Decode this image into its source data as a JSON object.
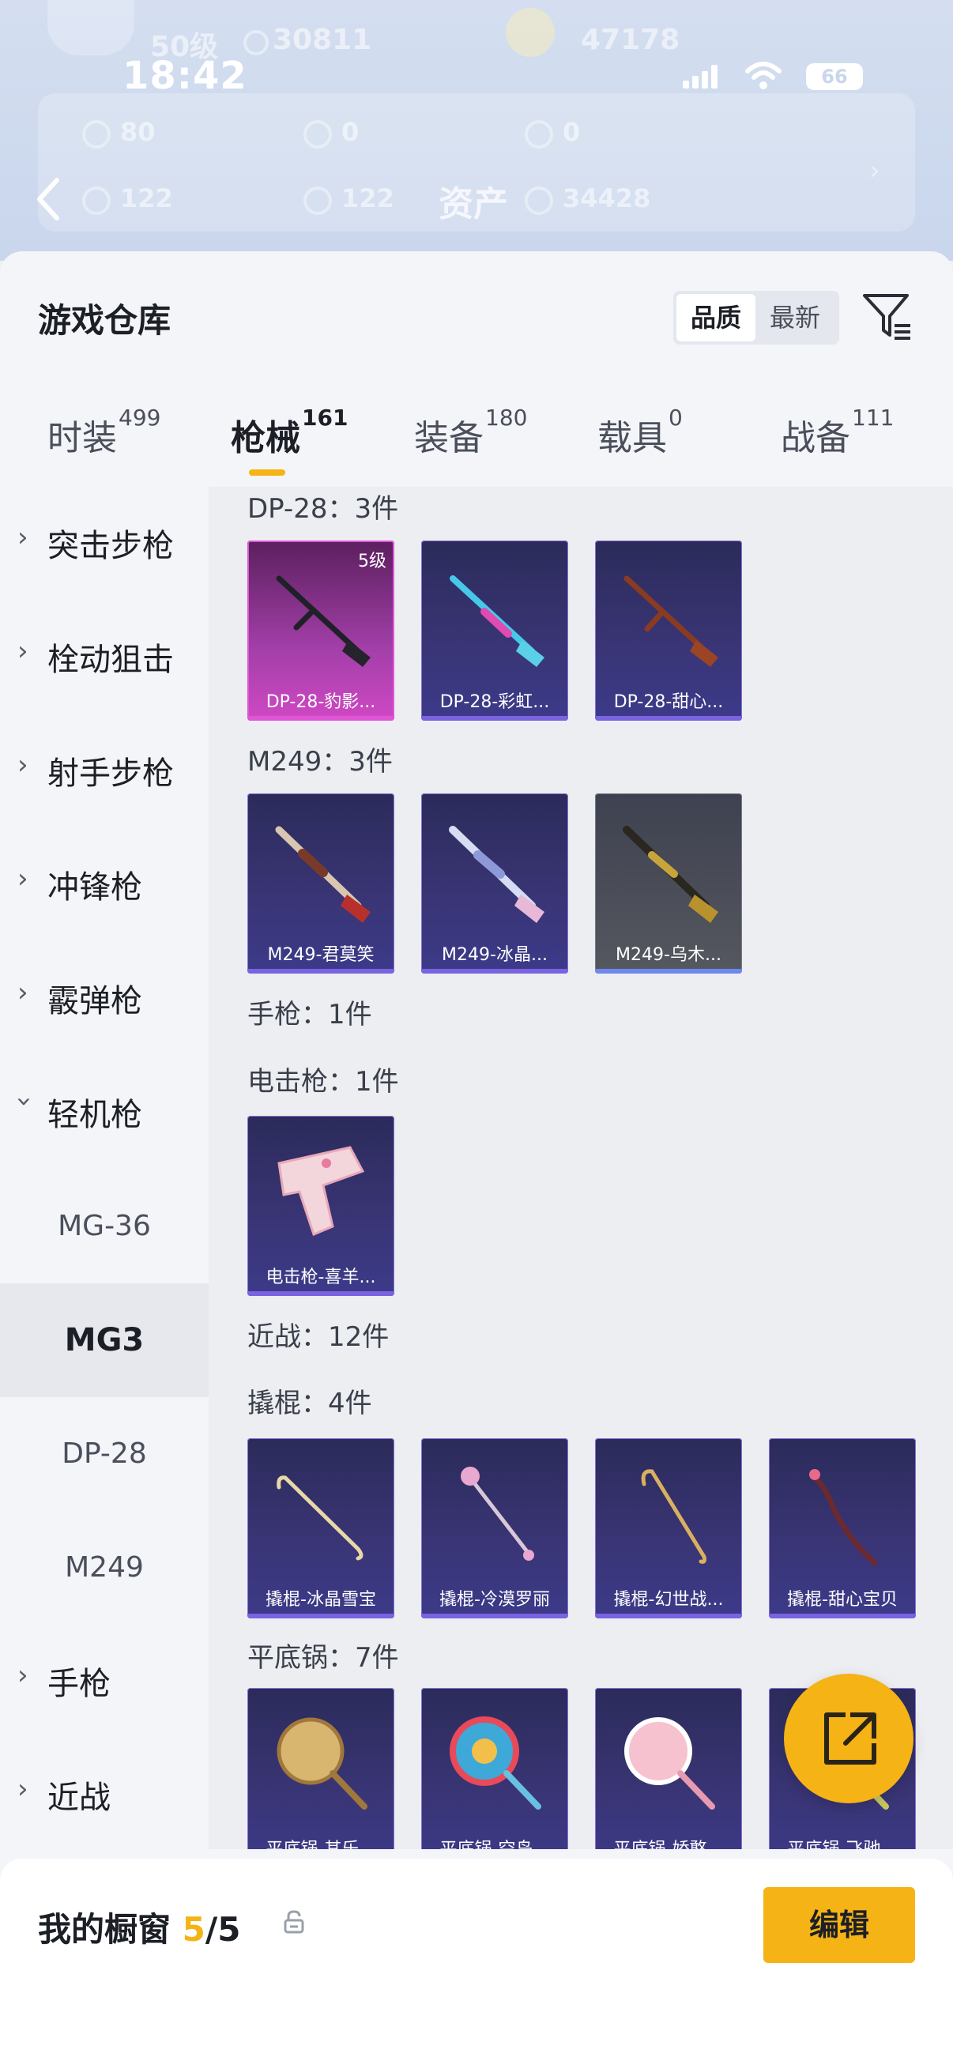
{
  "status": {
    "time": "18:42",
    "battery": "66"
  },
  "bg_header": {
    "level": "50级",
    "coins": "30811",
    "score": "47178",
    "stats_row1": [
      "80",
      "0",
      "0"
    ],
    "stats_row2": [
      "122",
      "122",
      "34428"
    ],
    "title": "资产"
  },
  "sheet": {
    "title": "游戏仓库"
  },
  "sort": {
    "quality": "品质",
    "newest": "最新"
  },
  "tabs": [
    {
      "label": "时装",
      "count": "499"
    },
    {
      "label": "枪械",
      "count": "161"
    },
    {
      "label": "装备",
      "count": "180"
    },
    {
      "label": "载具",
      "count": "0"
    },
    {
      "label": "战备",
      "count": "111"
    }
  ],
  "sidebar": {
    "items": [
      {
        "label": "突击步枪"
      },
      {
        "label": "栓动狙击"
      },
      {
        "label": "射手步枪"
      },
      {
        "label": "冲锋枪"
      },
      {
        "label": "霰弹枪"
      },
      {
        "label": "轻机枪"
      }
    ],
    "subitems": [
      "MG-36",
      "MG3",
      "DP-28",
      "M249"
    ],
    "more": [
      {
        "label": "手枪"
      },
      {
        "label": "近战"
      }
    ]
  },
  "groups": {
    "dp28": {
      "title": "DP-28：3件",
      "items": [
        {
          "name": "DP-28-豹影...",
          "level": "5级"
        },
        {
          "name": "DP-28-彩虹..."
        },
        {
          "name": "DP-28-甜心..."
        }
      ]
    },
    "m249": {
      "title": "M249：3件",
      "items": [
        {
          "name": "M249-君莫笑"
        },
        {
          "name": "M249-冰晶..."
        },
        {
          "name": "M249-乌木..."
        }
      ]
    },
    "pistol": {
      "title": "手枪：1件"
    },
    "stun": {
      "title": "电击枪：1件",
      "items": [
        {
          "name": "电击枪-喜羊..."
        }
      ]
    },
    "melee": {
      "title": "近战：12件"
    },
    "crowbar": {
      "title": "撬棍：4件",
      "items": [
        {
          "name": "撬棍-冰晶雪宝"
        },
        {
          "name": "撬棍-冷漠罗丽"
        },
        {
          "name": "撬棍-幻世战..."
        },
        {
          "name": "撬棍-甜心宝贝"
        }
      ]
    },
    "pan": {
      "title": "平底锅：7件",
      "items": [
        {
          "name": "平底锅-其乐..."
        },
        {
          "name": "平底锅-空岛..."
        },
        {
          "name": "平底锅-娇憨..."
        },
        {
          "name": "平底锅-飞驰..."
        }
      ]
    }
  },
  "bottom": {
    "label": "我的橱窗",
    "count": "5",
    "total": "/5",
    "edit": "编辑"
  },
  "colors": {
    "accent": "#f5b316",
    "card_purple": "#3a3576",
    "card_pink": "#d048c4"
  }
}
